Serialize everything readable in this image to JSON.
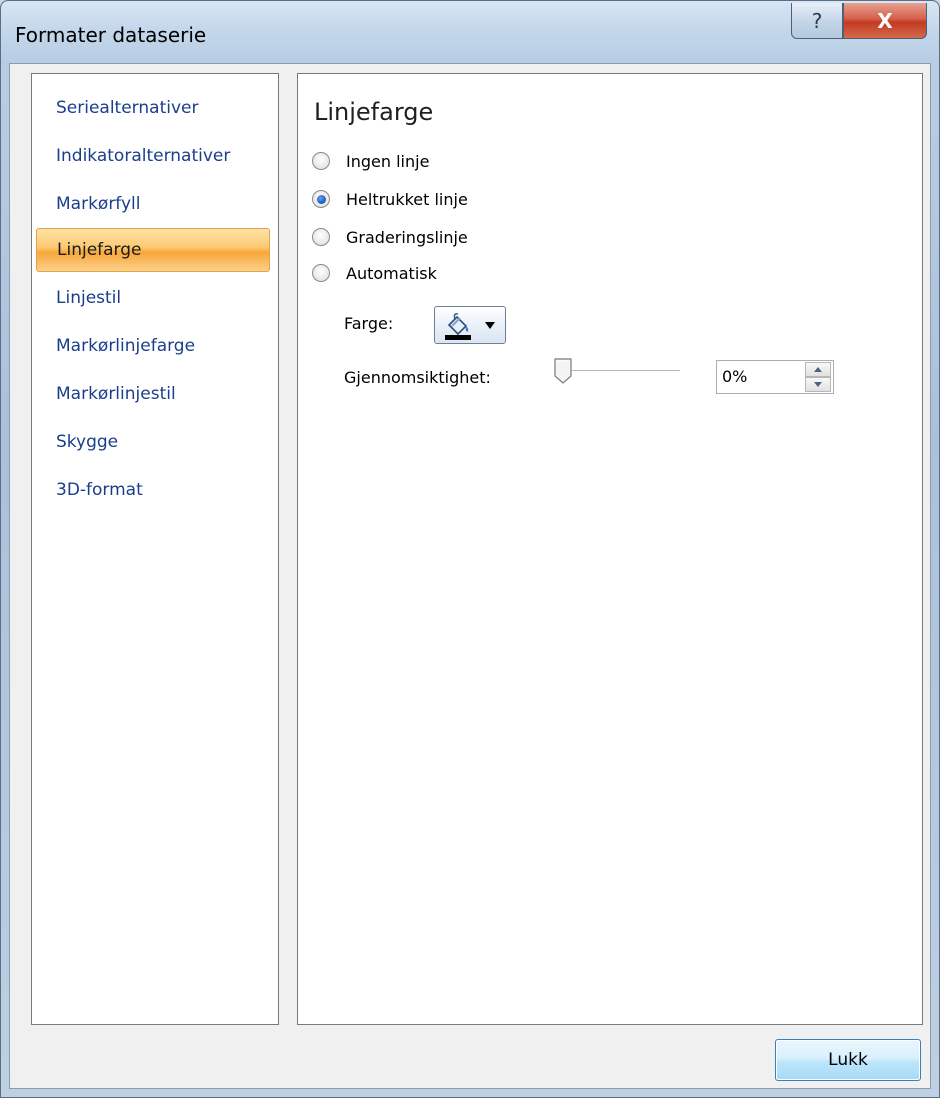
{
  "window": {
    "title": "Formater dataserie",
    "help_glyph": "?",
    "close_glyph": "X"
  },
  "nav": {
    "items": [
      {
        "label": "Seriealternativer",
        "selected": false
      },
      {
        "label": "Indikatoralternativer",
        "selected": false
      },
      {
        "label": "Markørfyll",
        "selected": false
      },
      {
        "label": "Linjefarge",
        "selected": true
      },
      {
        "label": "Linjestil",
        "selected": false
      },
      {
        "label": "Markørlinjefarge",
        "selected": false
      },
      {
        "label": "Markørlinjestil",
        "selected": false
      },
      {
        "label": "Skygge",
        "selected": false
      },
      {
        "label": "3D-format",
        "selected": false
      }
    ]
  },
  "content": {
    "section_title": "Linjefarge",
    "options": [
      {
        "label": "Ingen linje",
        "checked": false
      },
      {
        "label": "Heltrukket linje",
        "checked": true
      },
      {
        "label": "Graderingslinje",
        "checked": false
      },
      {
        "label": "Automatisk",
        "checked": false
      }
    ],
    "color_label": "Farge:",
    "color_value": "#000000",
    "transparency_label": "Gjennomsiktighet:",
    "transparency_value": "0%",
    "transparency_percent": 0
  },
  "footer": {
    "close_label": "Lukk"
  },
  "colors": {
    "selected_nav": "#fbc870",
    "nav_text": "#1a3e8c",
    "radio_dot": "#1f5fc4"
  }
}
